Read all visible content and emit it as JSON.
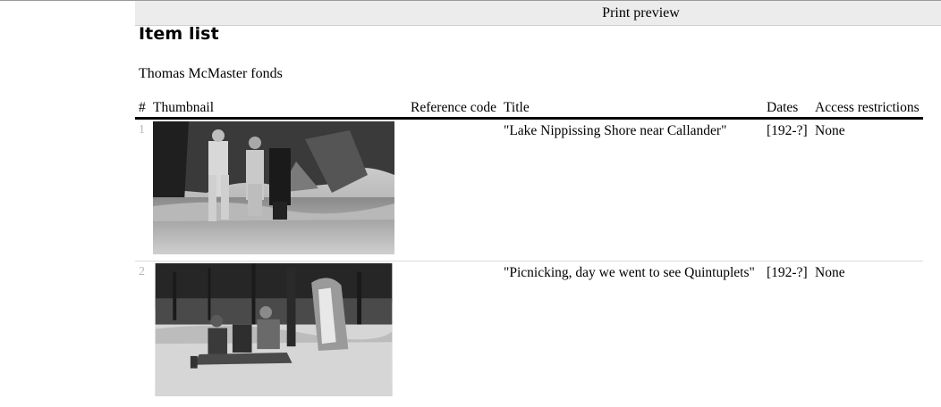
{
  "preview": {
    "label": "Print preview"
  },
  "page": {
    "title": "Item list",
    "fonds": "Thomas McMaster fonds"
  },
  "table": {
    "headers": {
      "num": "#",
      "thumbnail": "Thumbnail",
      "reference_code": "Reference code",
      "title": "Title",
      "dates": "Dates",
      "access": "Access restrictions"
    },
    "rows": [
      {
        "num": "1",
        "reference_code": "",
        "title": "\"Lake Nippissing Shore near Callander\"",
        "dates": "[192-?]",
        "access": "None"
      },
      {
        "num": "2",
        "reference_code": "",
        "title": "\"Picnicking, day we went to see Quintuplets\"",
        "dates": "[192-?]",
        "access": "None"
      }
    ]
  }
}
